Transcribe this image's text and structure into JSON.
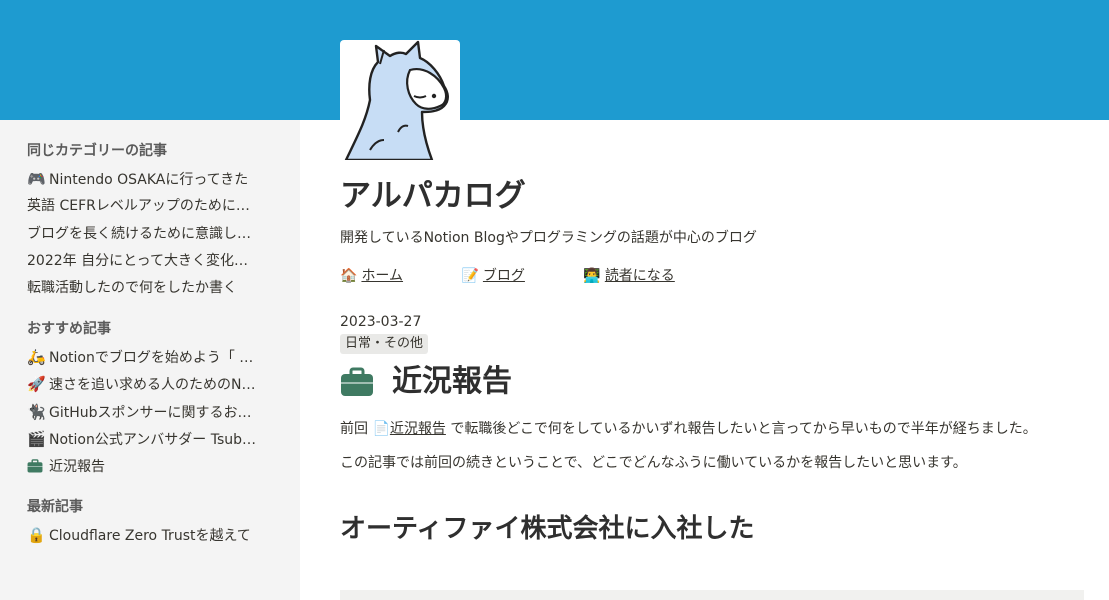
{
  "colors": {
    "banner": "#1e9bd0",
    "sidebar_bg": "#f4f4f4",
    "text": "#37352f",
    "tag_bg": "#e9e9e7",
    "briefcase": "#3f7a62"
  },
  "sidebar": {
    "sections": [
      {
        "heading": "同じカテゴリーの記事",
        "items": [
          {
            "emoji": "🎮",
            "label": "Nintendo OSAKAに行ってきた"
          },
          {
            "emoji": "",
            "label": "英語 CEFRレベルアップのために…"
          },
          {
            "emoji": "",
            "label": "ブログを長く続けるために意識し…"
          },
          {
            "emoji": "",
            "label": "2022年 自分にとって大きく変化…"
          },
          {
            "emoji": "",
            "label": "転職活動したので何をしたか書く"
          }
        ]
      },
      {
        "heading": "おすすめ記事",
        "items": [
          {
            "emoji": "🛵",
            "label": "Notionでブログを始めよう「 …"
          },
          {
            "emoji": "🚀",
            "label": "速さを追い求める人のためのN…"
          },
          {
            "emoji": "🐈‍⬛",
            "label": "GitHubスポンサーに関するお…"
          },
          {
            "emoji": "🎬",
            "label": "Notion公式アンバサダー Tsub…"
          },
          {
            "emoji": "briefcase",
            "label": "近況報告"
          }
        ]
      },
      {
        "heading": "最新記事",
        "items": [
          {
            "emoji": "🔒",
            "label": "Cloudflare Zero Trustを越えて"
          }
        ]
      }
    ]
  },
  "blog": {
    "title": "アルパカログ",
    "description": "開発しているNotion Blogやプログラミングの話題が中心のブログ",
    "nav": [
      {
        "emoji": "🏠",
        "label": "ホーム"
      },
      {
        "emoji": "📝",
        "label": "ブログ"
      },
      {
        "emoji": "👨‍💻",
        "label": "読者になる"
      }
    ]
  },
  "post": {
    "date": "2023-03-27",
    "tag": "日常・その他",
    "title": "近況報告",
    "para1_prefix": "前回",
    "para1_mention": "近況報告",
    "para1_rest": "で転職後どこで何をしているかいずれ報告したいと言ってから早いもので半年が経ちました。",
    "para2": "この記事では前回の続きということで、どこでどんなふうに働いているかを報告したいと思います。",
    "heading2": "オーティファイ株式会社に入社した"
  }
}
